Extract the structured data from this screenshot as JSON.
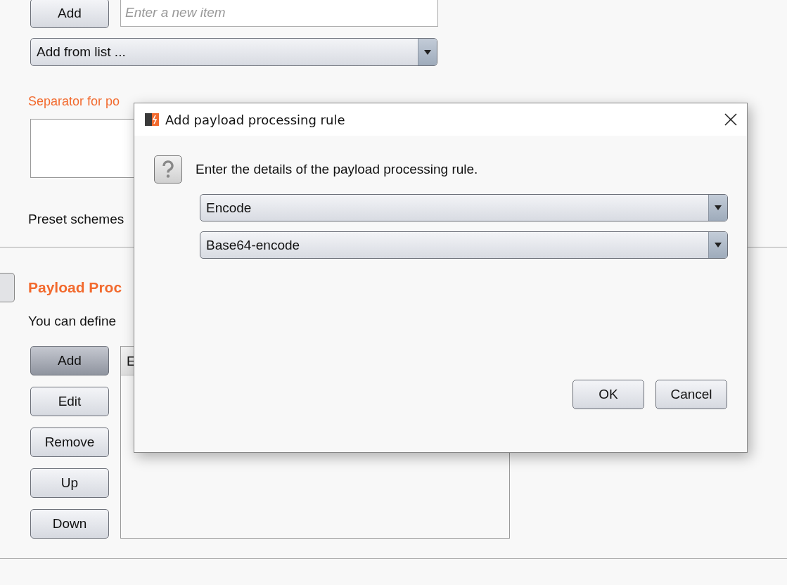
{
  "top_editor": {
    "add_button": "Add",
    "item_field": {
      "placeholder": "Enter a new item"
    },
    "add_from_list": {
      "value": "Add from list ..."
    }
  },
  "separator": {
    "label": "Separator for po"
  },
  "preset_schemes": {
    "label": "Preset schemes"
  },
  "payload_processing": {
    "title": "Payload Proc",
    "description": "You can define",
    "buttons": [
      {
        "label": "Add",
        "pressed": true
      },
      {
        "label": "Edit",
        "pressed": false
      },
      {
        "label": "Remove",
        "pressed": false
      },
      {
        "label": "Up",
        "pressed": false
      },
      {
        "label": "Down",
        "pressed": false
      }
    ],
    "table": {
      "columns": [
        "E"
      ]
    }
  },
  "dialog": {
    "title": "Add payload processing rule",
    "message": "Enter the details of the payload processing rule.",
    "dropdowns": [
      {
        "value": "Encode"
      },
      {
        "value": "Base64-encode"
      }
    ],
    "buttons": [
      "OK",
      "Cancel"
    ]
  }
}
